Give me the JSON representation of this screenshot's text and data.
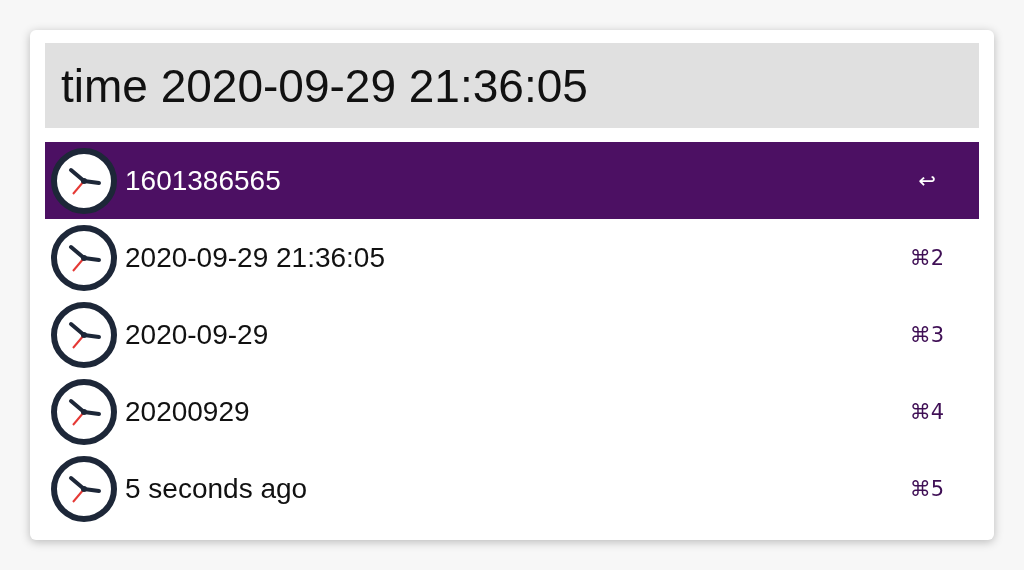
{
  "search": {
    "value": "time 2020-09-29 21:36:05"
  },
  "results": [
    {
      "title": "1601386565",
      "shortcut": "↩",
      "selected": true
    },
    {
      "title": "2020-09-29 21:36:05",
      "shortcut": "⌘2",
      "selected": false
    },
    {
      "title": "2020-09-29",
      "shortcut": "⌘3",
      "selected": false
    },
    {
      "title": "20200929",
      "shortcut": "⌘4",
      "selected": false
    },
    {
      "title": "5 seconds ago",
      "shortcut": "⌘5",
      "selected": false
    }
  ]
}
